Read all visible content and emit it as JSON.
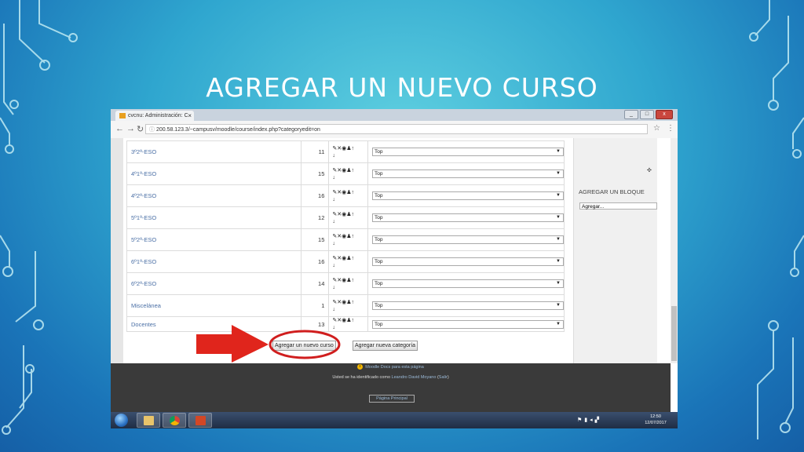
{
  "slide": {
    "title": "AGREGAR UN NUEVO CURSO"
  },
  "browser": {
    "tab_title": "cvcnu: Administración: C",
    "url": "200.58.123.3/~campusv/moodle/course/index.php?categoryedit=on",
    "window_buttons": [
      "_",
      "□",
      "x"
    ]
  },
  "categories": [
    {
      "name": "3º2ª-ESO",
      "count": "11",
      "parent": "Top"
    },
    {
      "name": "4º1ª-ESO",
      "count": "15",
      "parent": "Top"
    },
    {
      "name": "4º2ª-ESO",
      "count": "16",
      "parent": "Top"
    },
    {
      "name": "5º1ª-ESO",
      "count": "12",
      "parent": "Top"
    },
    {
      "name": "5º2ª-ESO",
      "count": "15",
      "parent": "Top"
    },
    {
      "name": "6º1ª-ESO",
      "count": "16",
      "parent": "Top"
    },
    {
      "name": "6º2ª-ESO",
      "count": "14",
      "parent": "Top"
    },
    {
      "name": "Miscelánea",
      "count": "1",
      "parent": "Top"
    },
    {
      "name": "Docentes",
      "count": "13",
      "parent": "Top"
    }
  ],
  "buttons": {
    "add_course": "Agregar un nuevo curso",
    "add_category": "Agregar nueva categoría"
  },
  "sidebar": {
    "block_title": "AGREGAR UN BLOQUE",
    "block_select": "Agregar..."
  },
  "footer": {
    "docs_link": "Moodle Docs para esta página",
    "logged_prefix": "Usted se ha identificado como",
    "user_name": "Leandro David Moyano",
    "logout": "Salir",
    "home": "Página Principal"
  },
  "taskbar": {
    "time": "12:50",
    "date": "12/07/2017"
  },
  "annotation": {
    "arrow_color": "#e0251c",
    "circle_color": "#d01e1e"
  }
}
